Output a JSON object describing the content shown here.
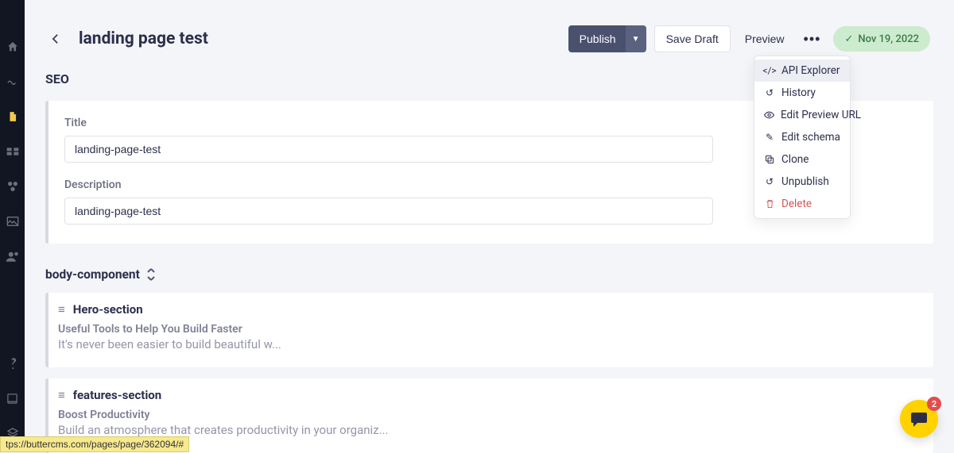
{
  "header": {
    "page_title": "landing page test",
    "publish_label": "Publish",
    "save_draft_label": "Save Draft",
    "preview_label": "Preview",
    "status_date": "Nov 19, 2022"
  },
  "dropdown": {
    "items": [
      {
        "label": "API Explorer",
        "icon": "code"
      },
      {
        "label": "History",
        "icon": "history"
      },
      {
        "label": "Edit Preview URL",
        "icon": "eye"
      },
      {
        "label": "Edit schema",
        "icon": "pencil"
      },
      {
        "label": "Clone",
        "icon": "copy"
      },
      {
        "label": "Unpublish",
        "icon": "undo"
      },
      {
        "label": "Delete",
        "icon": "trash"
      }
    ]
  },
  "seo": {
    "heading": "SEO",
    "title_label": "Title",
    "title_value": "landing-page-test",
    "description_label": "Description",
    "description_value": "landing-page-test"
  },
  "body_component": {
    "heading": "body-component",
    "blocks": [
      {
        "name": "Hero-section",
        "line1": "Useful Tools to Help You Build Faster",
        "line2": "It's never been easier to build beautiful w..."
      },
      {
        "name": "features-section",
        "line1": "Boost Productivity",
        "line2": "Build an atmosphere that creates productivity in your organiz..."
      }
    ]
  },
  "chat": {
    "badge": "2"
  },
  "footer": {
    "url_preview": "tps://buttercms.com/pages/page/362094/#"
  }
}
